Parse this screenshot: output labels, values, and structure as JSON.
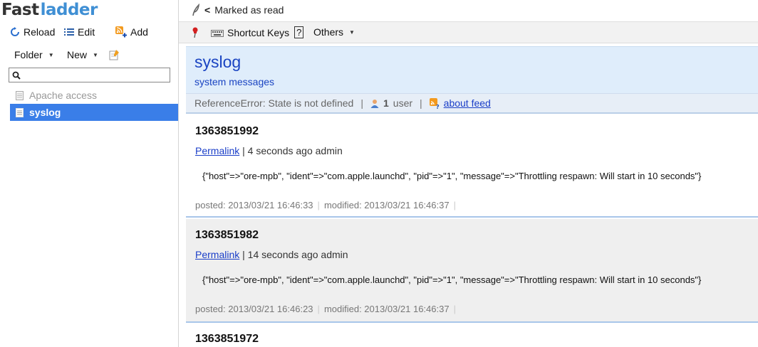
{
  "app": {
    "logo_part1": "Fast",
    "logo_part2": "ladder"
  },
  "sidebar": {
    "reload_label": "Reload",
    "edit_label": "Edit",
    "add_label": "Add",
    "folder_label": "Folder",
    "new_label": "New",
    "search_placeholder": "",
    "feeds": [
      {
        "label": "Apache access",
        "state": "read"
      },
      {
        "label": "syslog",
        "state": "selected"
      }
    ]
  },
  "status": {
    "back_symbol": "<",
    "text": "Marked as read"
  },
  "toolbar": {
    "shortcut_label": "Shortcut Keys",
    "shortcut_key": "?",
    "others_label": "Others"
  },
  "feed": {
    "title": "syslog",
    "description": "system messages",
    "error_text": "ReferenceError: State is not defined",
    "separator": "|",
    "user_count": "1",
    "user_label": "user",
    "about_label": "about feed"
  },
  "items": [
    {
      "title": "1363851992",
      "permalink_label": "Permalink",
      "meta": "| 4 seconds ago admin",
      "body": "{\"host\"=>\"ore-mpb\", \"ident\"=>\"com.apple.launchd\", \"pid\"=>\"1\", \"message\"=>\"Throttling respawn: Will start in 10 seconds\"}",
      "posted": "posted: 2013/03/21 16:46:33",
      "modified": "modified: 2013/03/21 16:46:37"
    },
    {
      "title": "1363851982",
      "permalink_label": "Permalink",
      "meta": "| 14 seconds ago admin",
      "body": "{\"host\"=>\"ore-mpb\", \"ident\"=>\"com.apple.launchd\", \"pid\"=>\"1\", \"message\"=>\"Throttling respawn: Will start in 10 seconds\"}",
      "posted": "posted: 2013/03/21 16:46:23",
      "modified": "modified: 2013/03/21 16:46:37"
    },
    {
      "title": "1363851972"
    }
  ],
  "colors": {
    "accent": "#3a7ee8",
    "link": "#1a3ec8",
    "header_bg": "#dfedfb",
    "logo_blue": "#3f8fd4"
  }
}
